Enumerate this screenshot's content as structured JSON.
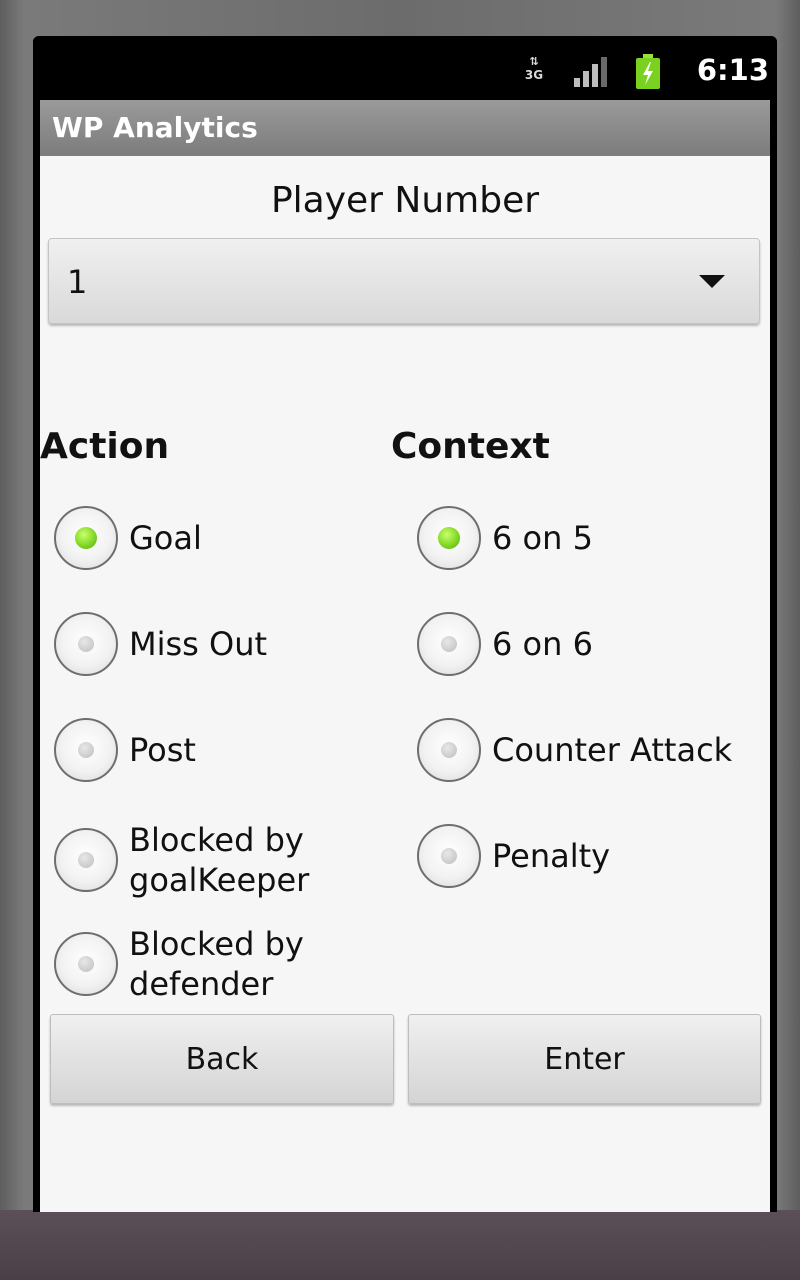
{
  "status_bar": {
    "network": "3G",
    "clock": "6:13",
    "icons": [
      "data-arrows-icon",
      "signal-icon",
      "battery-charging-icon"
    ]
  },
  "app": {
    "title": "WP Analytics"
  },
  "player": {
    "label": "Player Number",
    "selected": "1"
  },
  "action": {
    "heading": "Action",
    "options": [
      {
        "label": "Goal",
        "checked": true
      },
      {
        "label": "Miss Out",
        "checked": false
      },
      {
        "label": "Post",
        "checked": false
      },
      {
        "label": "Blocked by\ngoalKeeper",
        "checked": false
      },
      {
        "label": "Blocked by\ndefender",
        "checked": false
      }
    ]
  },
  "context": {
    "heading": "Context",
    "options": [
      {
        "label": "6 on 5",
        "checked": true
      },
      {
        "label": "6 on 6",
        "checked": false
      },
      {
        "label": "Counter Attack",
        "checked": false
      },
      {
        "label": "Penalty",
        "checked": false
      }
    ]
  },
  "buttons": {
    "back": "Back",
    "enter": "Enter"
  },
  "colors": {
    "accent_green": "#7cd321",
    "title_bar": "#8a8a8a",
    "background": "#f6f6f6"
  }
}
